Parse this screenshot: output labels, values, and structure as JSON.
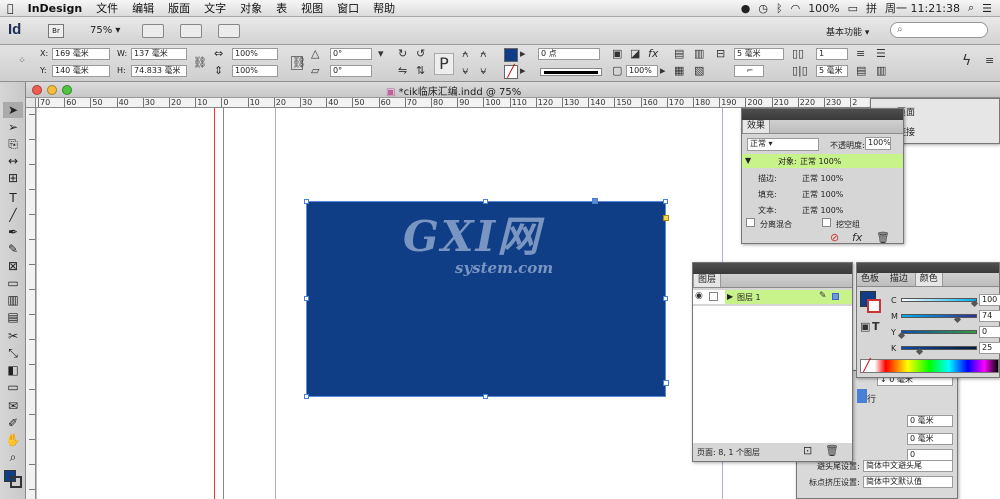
{
  "menubar": {
    "apple_icon": "apple-logo",
    "items": [
      "InDesign",
      "文件",
      "编辑",
      "版面",
      "文字",
      "对象",
      "表",
      "视图",
      "窗口",
      "帮助"
    ],
    "status": {
      "battery": "100%",
      "clock": "周一 11:21:38"
    }
  },
  "appbar": {
    "logo": "Id",
    "bridge": "Br",
    "zoom": "75%",
    "workspace": "基本功能",
    "search_placeholder": ""
  },
  "control": {
    "x_label": "X:",
    "x_value": "169 毫米",
    "y_label": "Y:",
    "y_value": "140 毫米",
    "w_label": "W:",
    "w_value": "137 毫米",
    "h_label": "H:",
    "h_value": "74.833 毫米",
    "scale_x": "100%",
    "scale_y": "100%",
    "rotate": "0°",
    "shear": "0°",
    "stroke_weight": "0 点",
    "opacity": "100%",
    "width_value": "5 毫米",
    "cols_value": "1",
    "gutter_value": "5 毫米",
    "fill_color": "#0f3e87"
  },
  "document": {
    "tab_title": "*cik临床汇编.indd @ 75%",
    "ruler_labels": [
      "70",
      "60",
      "50",
      "40",
      "30",
      "20",
      "10",
      "0",
      "10",
      "20",
      "30",
      "40",
      "50",
      "60",
      "70",
      "80",
      "90",
      "100",
      "110",
      "120",
      "130",
      "140",
      "150",
      "160",
      "170",
      "180",
      "190",
      "200",
      "210",
      "220",
      "230",
      "2"
    ],
    "rect_color": "#0f3e87",
    "watermark_main": "GXI网",
    "watermark_sub": "system.com"
  },
  "effects_panel": {
    "title": "效果",
    "blend_mode": "正常",
    "opacity_label": "不透明度:",
    "opacity_value": "100%",
    "rows": [
      {
        "name": "对象:",
        "value": "正常 100%"
      },
      {
        "name": "描边:",
        "value": "正常 100%"
      },
      {
        "name": "填充:",
        "value": "正常 100%"
      },
      {
        "name": "文本:",
        "value": "正常 100%"
      }
    ],
    "isolate_label": "分离混合",
    "knockout_label": "挖空组"
  },
  "layers_panel": {
    "title": "图层",
    "layer_name": "图层 1",
    "footer": "页面: 8, 1 个图层"
  },
  "color_panel": {
    "tabs": [
      "色板",
      "描边",
      "颜色"
    ],
    "channels": [
      {
        "name": "C",
        "value": "100"
      },
      {
        "name": "M",
        "value": "74"
      },
      {
        "name": "Y",
        "value": "0"
      },
      {
        "name": "K",
        "value": "25"
      }
    ]
  },
  "behind_panel": {
    "link_label1": "页面",
    "link_label2": "链接",
    "row_label": "行",
    "field1": "0 毫米",
    "field2": "0 毫米",
    "field3": "0",
    "setting1_label": "避头尾设置:",
    "setting1_value": "简体中文避头尾",
    "setting2_label": "标点挤压设置:",
    "setting2_value": "简体中文默认值"
  }
}
